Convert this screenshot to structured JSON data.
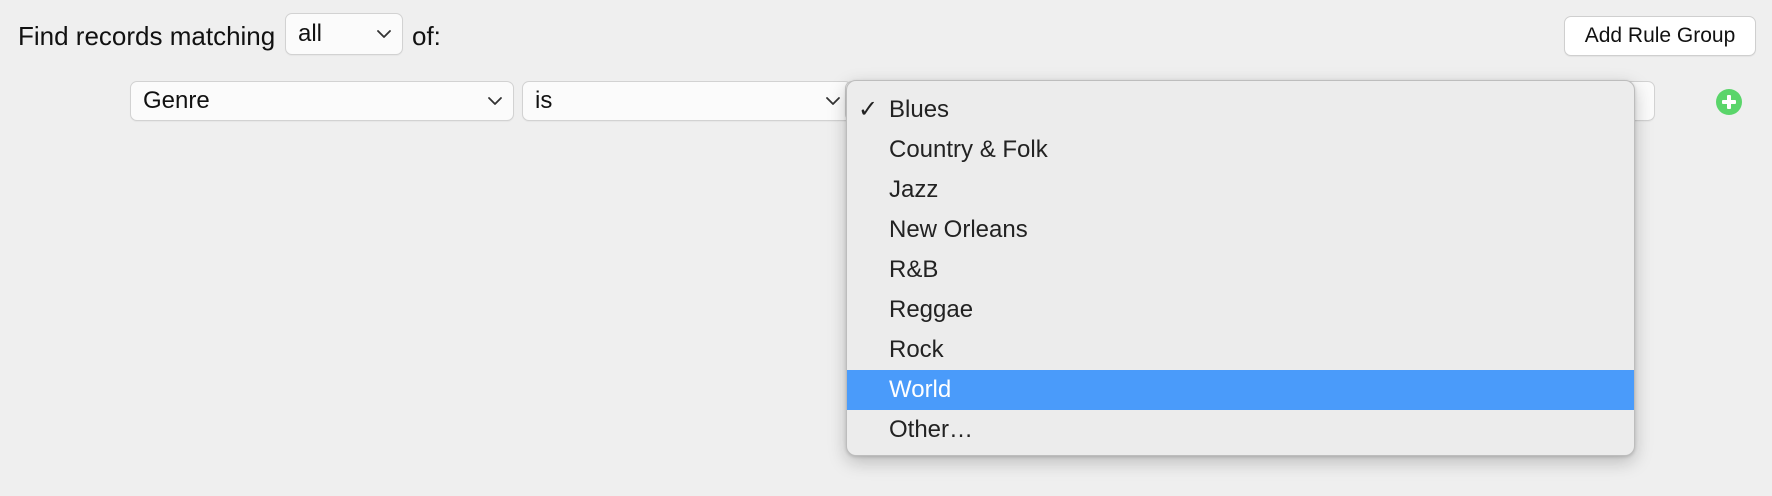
{
  "header": {
    "find_label": "Find records matching",
    "match_value": "all",
    "of_label": "of:",
    "add_rule_group_label": "Add Rule Group"
  },
  "rule": {
    "field_value": "Genre",
    "operator_value": "is",
    "value_value": ""
  },
  "dropdown": {
    "check_glyph": "✓",
    "items": [
      {
        "label": "Blues",
        "checked": true,
        "highlighted": false
      },
      {
        "label": "Country & Folk",
        "checked": false,
        "highlighted": false
      },
      {
        "label": "Jazz",
        "checked": false,
        "highlighted": false
      },
      {
        "label": "New Orleans",
        "checked": false,
        "highlighted": false
      },
      {
        "label": "R&B",
        "checked": false,
        "highlighted": false
      },
      {
        "label": "Reggae",
        "checked": false,
        "highlighted": false
      },
      {
        "label": "Rock",
        "checked": false,
        "highlighted": false
      },
      {
        "label": "World",
        "checked": false,
        "highlighted": true
      },
      {
        "label": "Other…",
        "checked": false,
        "highlighted": false
      }
    ]
  },
  "colors": {
    "highlight": "#4a9bfa",
    "add_icon": "#5ad56a"
  },
  "icons": {
    "add_rule": "plus-circle-icon",
    "select_arrow": "chevron-down-icon",
    "checkmark": "checkmark-icon"
  }
}
